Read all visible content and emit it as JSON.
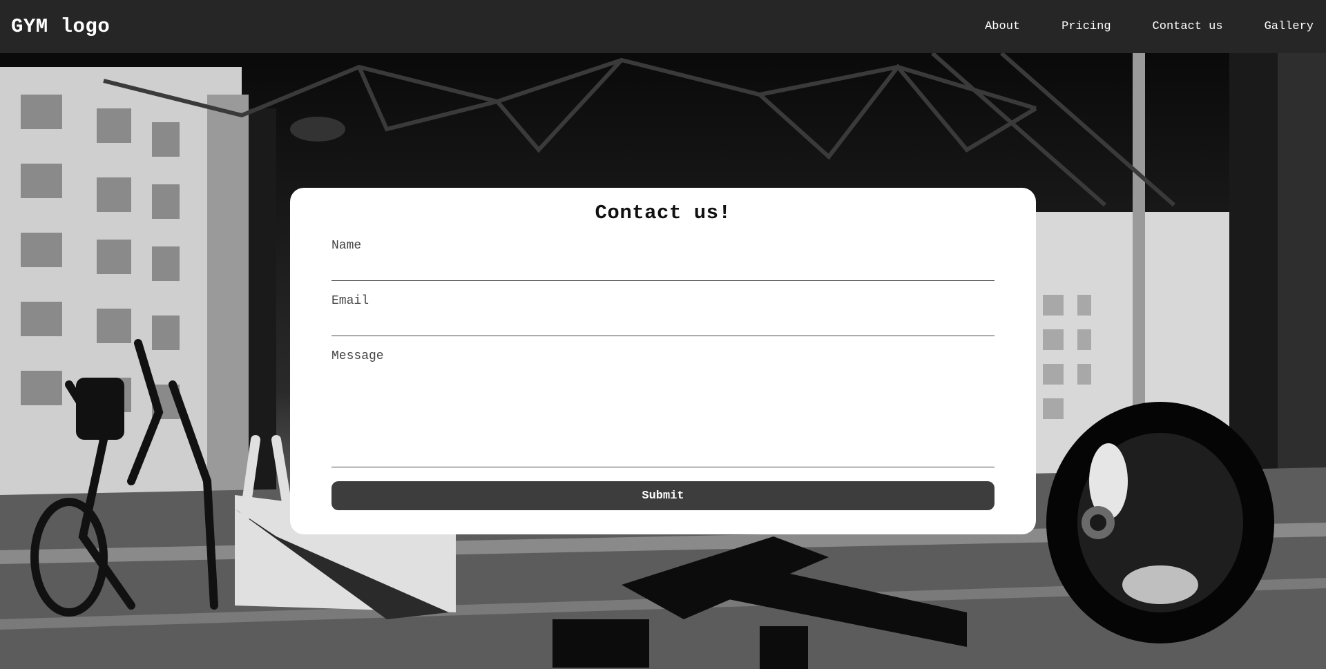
{
  "header": {
    "logo": "GYM logo",
    "nav": [
      {
        "label": "About"
      },
      {
        "label": "Pricing"
      },
      {
        "label": "Contact us"
      },
      {
        "label": "Gallery"
      }
    ]
  },
  "contact_form": {
    "title": "Contact us!",
    "fields": {
      "name": {
        "label": "Name",
        "value": ""
      },
      "email": {
        "label": "Email",
        "value": ""
      },
      "message": {
        "label": "Message",
        "value": ""
      }
    },
    "submit_label": "Submit"
  },
  "colors": {
    "navbar_bg": "#262626",
    "card_bg": "#ffffff",
    "button_bg": "#3d3d3d",
    "text_light": "#ffffff"
  }
}
